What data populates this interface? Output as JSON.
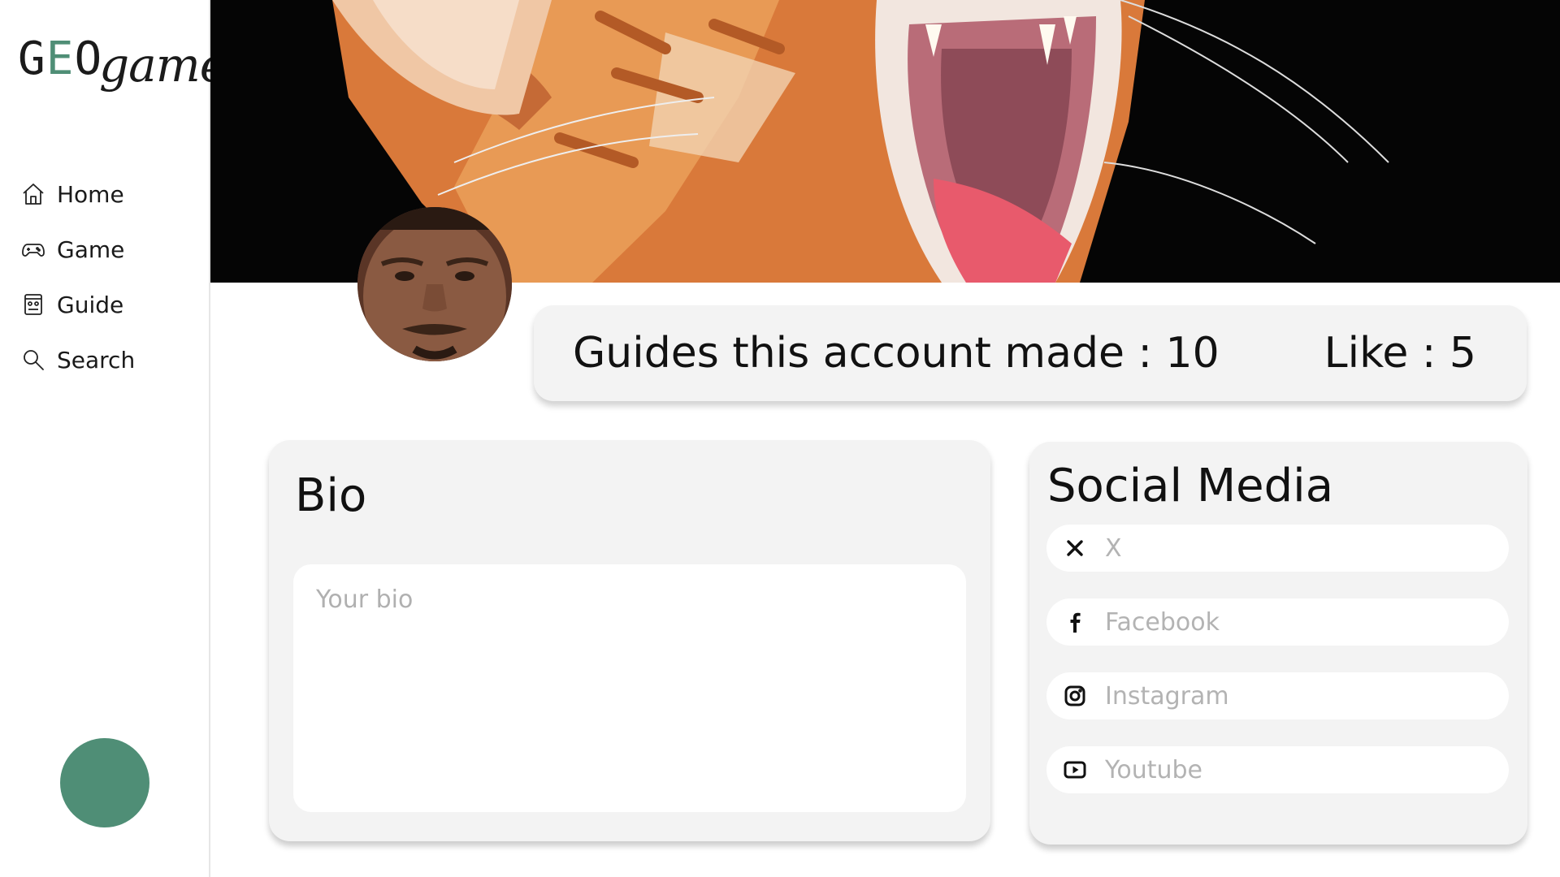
{
  "app": {
    "logo_geo_g": "G",
    "logo_geo_e": "E",
    "logo_geo_o": "O",
    "logo_game": "game",
    "accent_color": "#4f8e76"
  },
  "sidebar": {
    "items": [
      {
        "label": "Home",
        "icon": "home-icon"
      },
      {
        "label": "Game",
        "icon": "gamepad-icon"
      },
      {
        "label": "Guide",
        "icon": "guide-icon"
      },
      {
        "label": "Search",
        "icon": "search-icon"
      }
    ]
  },
  "profile": {
    "guides_label": "Guides this account made : 10",
    "likes_label": "Like : 5"
  },
  "bio": {
    "title": "Bio",
    "placeholder": "Your bio"
  },
  "social": {
    "title": "Social Media",
    "fields": [
      {
        "placeholder": "X",
        "icon": "x-icon"
      },
      {
        "placeholder": "Facebook",
        "icon": "facebook-icon"
      },
      {
        "placeholder": "Instagram",
        "icon": "instagram-icon"
      },
      {
        "placeholder": "Youtube",
        "icon": "youtube-icon"
      }
    ]
  }
}
